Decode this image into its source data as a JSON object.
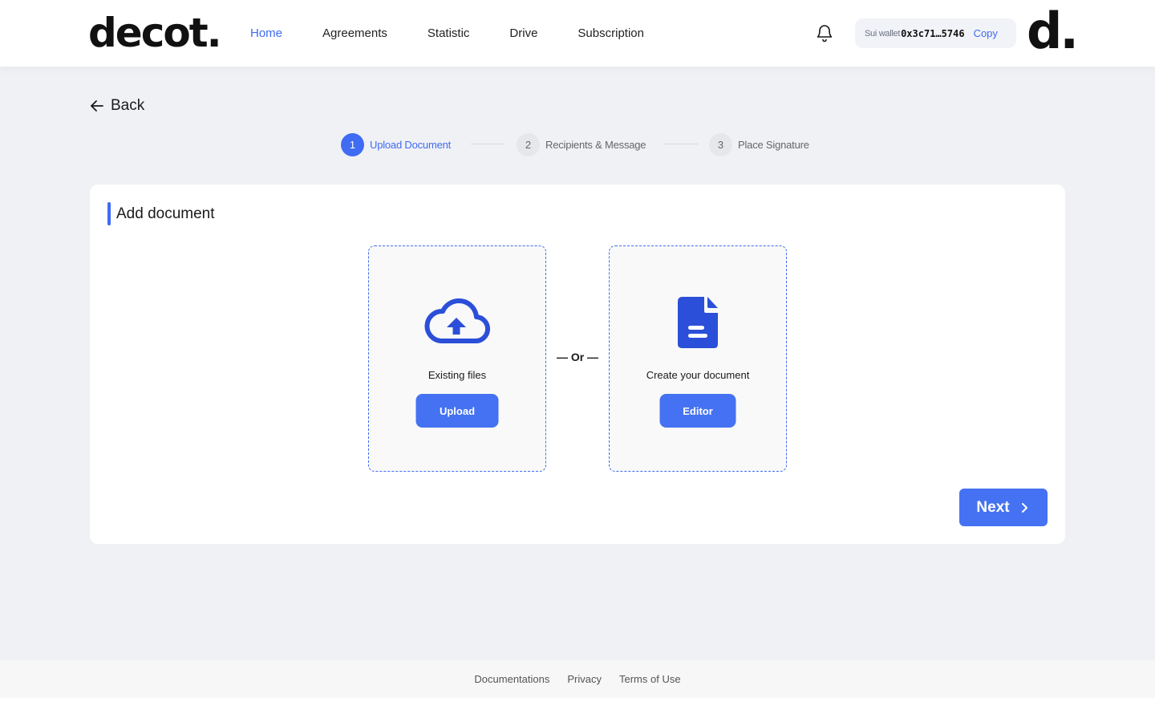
{
  "header": {
    "logo": "decot.",
    "nav": [
      {
        "label": "Home",
        "active": true
      },
      {
        "label": "Agreements",
        "active": false
      },
      {
        "label": "Statistic",
        "active": false
      },
      {
        "label": "Drive",
        "active": false
      },
      {
        "label": "Subscription",
        "active": false
      }
    ],
    "wallet": {
      "label": "Sui wallet",
      "address": "0x3c71…5746",
      "copy_label": "Copy"
    },
    "avatar": "d."
  },
  "back_label": "Back",
  "stepper": [
    {
      "number": "1",
      "label": "Upload Document",
      "active": true
    },
    {
      "number": "2",
      "label": "Recipients & Message",
      "active": false
    },
    {
      "number": "3",
      "label": "Place Signature",
      "active": false
    }
  ],
  "card": {
    "title": "Add document",
    "upload_option": {
      "text": "Existing files",
      "button_label": "Upload",
      "icon": "cloud-upload-icon"
    },
    "or_label": "— Or —",
    "editor_option": {
      "text": "Create your document",
      "button_label": "Editor",
      "icon": "document-icon"
    },
    "next_label": "Next"
  },
  "footer": {
    "links": [
      "Documentations",
      "Privacy",
      "Terms of Use"
    ]
  },
  "colors": {
    "accent": "#3f6cf2",
    "button": "#4472f2",
    "icon": "#2b4fd8",
    "background": "#f0f1f5"
  }
}
